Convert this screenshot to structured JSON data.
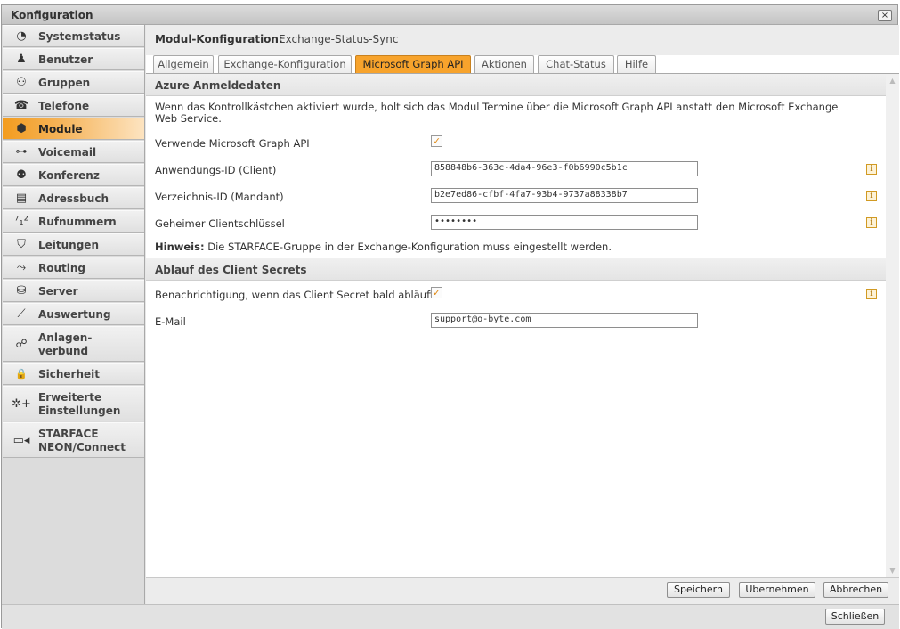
{
  "window": {
    "title": "Konfiguration",
    "close_icon": "×"
  },
  "sidebar": {
    "items": [
      {
        "label": "Systemstatus",
        "icon": "◔"
      },
      {
        "label": "Benutzer",
        "icon": "♟"
      },
      {
        "label": "Gruppen",
        "icon": "⚇"
      },
      {
        "label": "Telefone",
        "icon": "☎"
      },
      {
        "label": "Module",
        "icon": "⬢"
      },
      {
        "label": "Voicemail",
        "icon": "⊶"
      },
      {
        "label": "Konferenz",
        "icon": "⚉"
      },
      {
        "label": "Adressbuch",
        "icon": "▤"
      },
      {
        "label": "Rufnummern",
        "icon": "⁷₁²"
      },
      {
        "label": "Leitungen",
        "icon": "⛉"
      },
      {
        "label": "Routing",
        "icon": "⤳"
      },
      {
        "label": "Server",
        "icon": "⛁"
      },
      {
        "label": "Auswertung",
        "icon": "⟋"
      },
      {
        "label": "Anlagen-\nverbund",
        "icon": "☍"
      },
      {
        "label": "Sicherheit",
        "icon": "🔒"
      },
      {
        "label": "Erweiterte\nEinstellungen",
        "icon": "✲+"
      },
      {
        "label": "STARFACE\nNEON/Connect",
        "icon": "▭◂"
      }
    ],
    "active": "Module"
  },
  "header": {
    "label": "Modul-Konfiguration:",
    "module_name": "Exchange-Status-Sync"
  },
  "tabs": [
    {
      "label": "Allgemein"
    },
    {
      "label": "Exchange-Konfiguration"
    },
    {
      "label": "Microsoft Graph API"
    },
    {
      "label": "Aktionen"
    },
    {
      "label": "Chat-Status"
    },
    {
      "label": "Hilfe"
    }
  ],
  "active_tab": "Microsoft Graph API",
  "azure": {
    "title": "Azure Anmeldedaten",
    "description": "Wenn das Kontrollkästchen aktiviert wurde, holt sich das Modul Termine über die Microsoft Graph API anstatt den Microsoft Exchange Web Service.",
    "use_graph_label": "Verwende Microsoft Graph API",
    "use_graph_checked": "✓",
    "app_id_label": "Anwendungs-ID (Client)",
    "app_id_value": "858848b6-363c-4da4-96e3-f0b6990c5b1c",
    "tenant_id_label": "Verzeichnis-ID (Mandant)",
    "tenant_id_value": "b2e7ed86-cfbf-4fa7-93b4-9737a88338b7",
    "secret_label": "Geheimer Clientschlüssel",
    "secret_value": "••••••••",
    "hint_label": "Hinweis:",
    "hint_text": "Die STARFACE-Gruppe in der Exchange-Konfiguration muss eingestellt werden.",
    "info_glyph": "i"
  },
  "expiry": {
    "title": "Ablauf des Client Secrets",
    "notify_label": "Benachrichtigung, wenn das Client Secret bald abläuft",
    "notify_checked": "✓",
    "email_label": "E-Mail",
    "email_value": "support@o-byte.com"
  },
  "footer": {
    "save": "Speichern",
    "apply": "Übernehmen",
    "cancel": "Abbrechen"
  },
  "bottom": {
    "close": "Schließen"
  },
  "colors": {
    "accent": "#f7a32c",
    "active_nav": "#f39c1e"
  }
}
